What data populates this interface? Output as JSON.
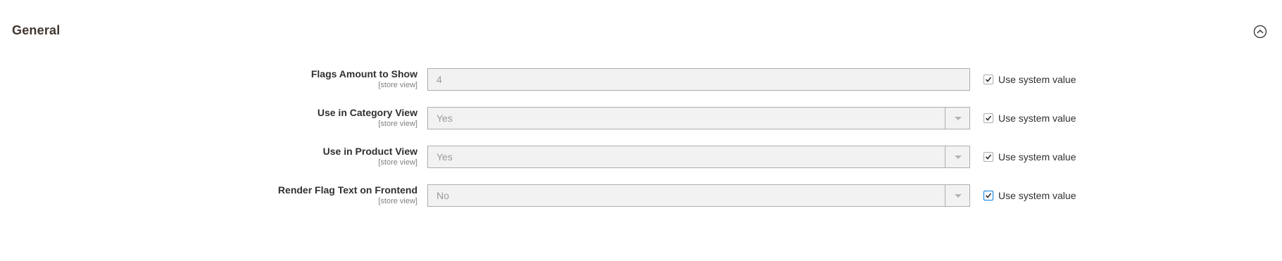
{
  "section": {
    "title": "General",
    "collapse_icon": "chevron-up-circle-icon"
  },
  "fields": [
    {
      "label": "Flags Amount to Show",
      "scope": "[store view]",
      "type": "input",
      "value": "4",
      "use_system_value_label": "Use system value",
      "use_system_value_checked": true
    },
    {
      "label": "Use in Category View",
      "scope": "[store view]",
      "type": "select",
      "value": "Yes",
      "use_system_value_label": "Use system value",
      "use_system_value_checked": true
    },
    {
      "label": "Use in Product View",
      "scope": "[store view]",
      "type": "select",
      "value": "Yes",
      "use_system_value_label": "Use system value",
      "use_system_value_checked": true
    },
    {
      "label": "Render Flag Text on Frontend",
      "scope": "[store view]",
      "type": "select",
      "value": "No",
      "use_system_value_label": "Use system value",
      "use_system_value_checked": true
    }
  ],
  "colors": {
    "focus_border": "#007bdb",
    "disabled_bg": "#f2f2f2",
    "border": "#adadad"
  }
}
